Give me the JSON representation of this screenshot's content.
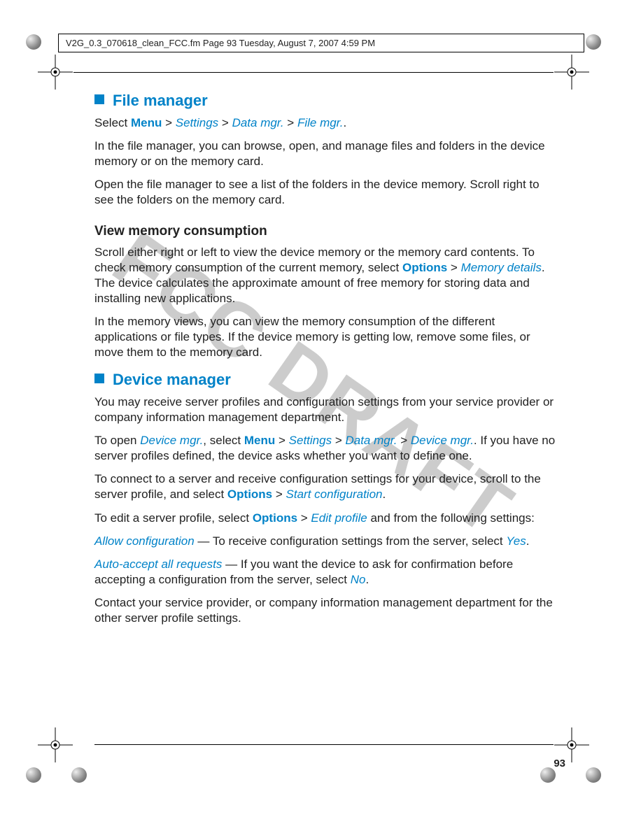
{
  "header": "V2G_0.3_070618_clean_FCC.fm  Page 93  Tuesday, August 7, 2007  4:59 PM",
  "watermark": "FCC DRAFT",
  "page_number": "93",
  "sections": {
    "file_manager": {
      "title": "File manager",
      "p1_a": "Select ",
      "p1_menu": "Menu",
      "p1_gt1": " > ",
      "p1_settings": "Settings",
      "p1_gt2": " > ",
      "p1_datamgr": "Data mgr.",
      "p1_gt3": " > ",
      "p1_filemgr": "File mgr.",
      "p1_end": ".",
      "p2": "In the file manager, you can browse, open, and manage files and folders in the device memory or on the memory card.",
      "p3": "Open the file manager to see a list of the folders in the device memory. Scroll right to see the folders on the memory card.",
      "sub": {
        "title": "View memory consumption",
        "p1_a": "Scroll either right or left to view the device memory or the memory card contents. To check memory consumption of the current memory, select ",
        "p1_options": "Options",
        "p1_gt": " > ",
        "p1_memdetails": "Memory details",
        "p1_b": ". The device calculates the approximate amount of free memory for storing data and installing new applications.",
        "p2": "In the memory views, you can view the memory consumption of the different applications or file types. If the device memory is getting low, remove some files, or move them to the memory card."
      }
    },
    "device_manager": {
      "title": "Device manager",
      "p1": "You may receive server profiles and configuration settings from your service provider or company information management department.",
      "p2_a": "To open ",
      "p2_devmgr1": "Device mgr.",
      "p2_b": ", select ",
      "p2_menu": "Menu",
      "p2_gt1": " > ",
      "p2_settings": "Settings",
      "p2_gt2": " > ",
      "p2_datamgr": "Data mgr.",
      "p2_gt3": " > ",
      "p2_devmgr2": "Device mgr.",
      "p2_end": ". If you have no server profiles defined, the device asks whether you want to define one.",
      "p3_a": "To connect to a server and receive configuration settings for your device, scroll to the server profile, and select ",
      "p3_options": "Options",
      "p3_gt": " > ",
      "p3_start": "Start configuration",
      "p3_end": ".",
      "p4_a": "To edit a server profile, select ",
      "p4_options": "Options",
      "p4_gt": " > ",
      "p4_edit": "Edit profile",
      "p4_b": " and from the following settings:",
      "p5_term": "Allow configuration",
      "p5_a": " — To receive configuration settings from the server, select ",
      "p5_yes": "Yes",
      "p5_end": ".",
      "p6_term": "Auto-accept all requests",
      "p6_a": " — If you want the device to ask for confirmation before accepting a configuration from the server, select ",
      "p6_no": "No",
      "p6_end": ".",
      "p7": "Contact your service provider, or company information management department for the other server profile settings."
    }
  }
}
